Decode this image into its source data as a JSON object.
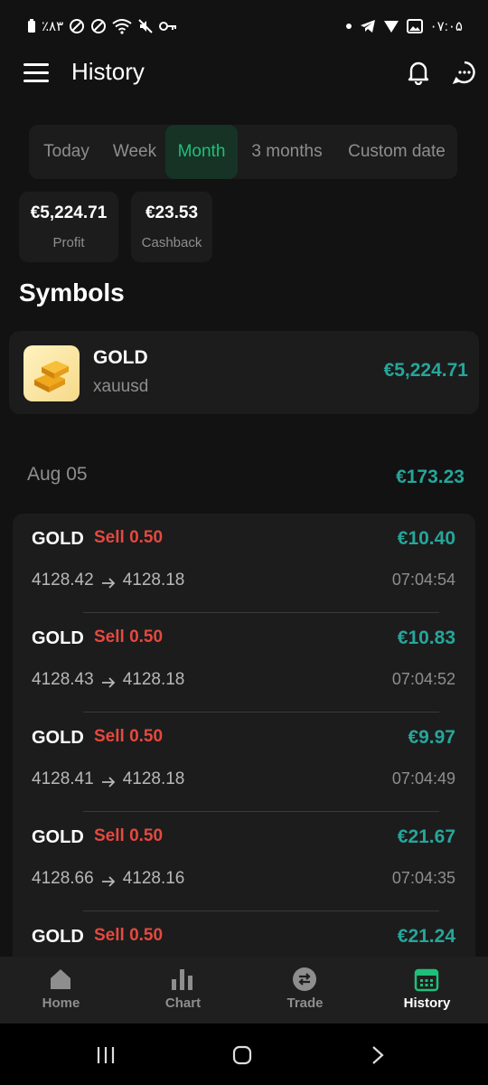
{
  "status_bar": {
    "left_text": "٪۸۳",
    "time": "۰۷:۰۵"
  },
  "header": {
    "title": "History"
  },
  "tabs": [
    {
      "label": "Today",
      "active": false
    },
    {
      "label": "Week",
      "active": false
    },
    {
      "label": "Month",
      "active": true
    },
    {
      "label": "3 months",
      "active": false
    },
    {
      "label": "Custom date",
      "active": false
    }
  ],
  "summary": {
    "profit_value": "€5,224.71",
    "profit_label": "Profit",
    "cashback_value": "€23.53",
    "cashback_label": "Cashback"
  },
  "symbols_section": {
    "title": "Symbols",
    "items": [
      {
        "name": "GOLD",
        "code": "xauusd",
        "value": "€5,224.71"
      }
    ]
  },
  "day_group": {
    "date": "Aug 05",
    "total": "€173.23"
  },
  "trades": [
    {
      "symbol": "GOLD",
      "side": "Sell 0.50",
      "profit": "€10.40",
      "open": "4128.42",
      "close": "4128.18",
      "time": "07:04:54"
    },
    {
      "symbol": "GOLD",
      "side": "Sell 0.50",
      "profit": "€10.83",
      "open": "4128.43",
      "close": "4128.18",
      "time": "07:04:52"
    },
    {
      "symbol": "GOLD",
      "side": "Sell 0.50",
      "profit": "€9.97",
      "open": "4128.41",
      "close": "4128.18",
      "time": "07:04:49"
    },
    {
      "symbol": "GOLD",
      "side": "Sell 0.50",
      "profit": "€21.67",
      "open": "4128.66",
      "close": "4128.16",
      "time": "07:04:35"
    },
    {
      "symbol": "GOLD",
      "side": "Sell 0.50",
      "profit": "€21.24",
      "open": "",
      "close": "",
      "time": ""
    }
  ],
  "bottom_nav": [
    {
      "label": "Home",
      "icon": "home-icon",
      "active": false
    },
    {
      "label": "Chart",
      "icon": "chart-icon",
      "active": false
    },
    {
      "label": "Trade",
      "icon": "trade-icon",
      "active": false
    },
    {
      "label": "History",
      "icon": "calendar-icon",
      "active": true
    }
  ],
  "colors": {
    "background": "#121212",
    "card": "#1c1c1c",
    "accent_green": "#1fbf7a",
    "profit_teal": "#26a69a",
    "sell_red": "#e5493f"
  }
}
